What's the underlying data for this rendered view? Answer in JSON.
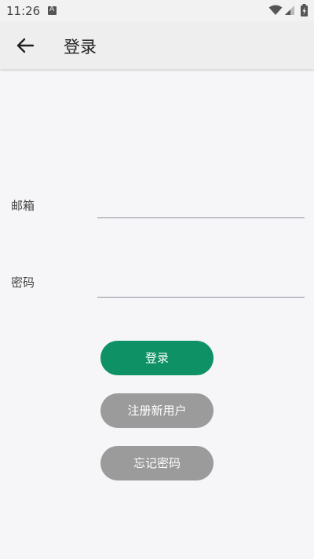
{
  "status_bar": {
    "time": "11:26",
    "notification_icon": "a-badge-icon",
    "wifi_icon": "wifi-icon",
    "signal_icon": "signal-icon",
    "battery_icon": "battery-charging-icon"
  },
  "app_bar": {
    "back_icon": "arrow-left-icon",
    "title": "登录"
  },
  "form": {
    "email_label": "邮箱",
    "email_value": "",
    "password_label": "密码",
    "password_value": ""
  },
  "buttons": {
    "login": "登录",
    "register": "注册新用户",
    "forgot": "忘记密码"
  },
  "colors": {
    "primary": "#0e9165",
    "secondary_button": "#9b9b9b",
    "background": "#f6f6f8",
    "app_bar": "#eeeeee"
  }
}
